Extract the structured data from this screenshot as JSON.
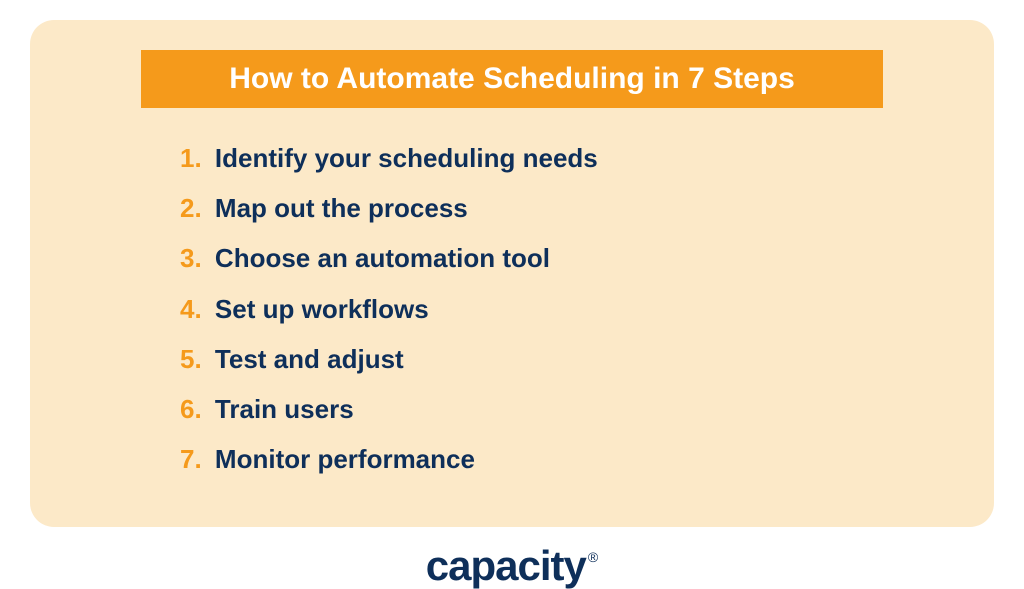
{
  "card": {
    "title": "How to Automate Scheduling in 7 Steps",
    "steps": [
      {
        "number": "1.",
        "text": "Identify your scheduling needs"
      },
      {
        "number": "2.",
        "text": "Map out the process"
      },
      {
        "number": "3.",
        "text": "Choose an automation tool"
      },
      {
        "number": "4.",
        "text": "Set up workflows"
      },
      {
        "number": "5.",
        "text": "Test and adjust"
      },
      {
        "number": "6.",
        "text": "Train users"
      },
      {
        "number": "7.",
        "text": " Monitor performance"
      }
    ]
  },
  "logo": {
    "text": "capacity",
    "registered": "®"
  },
  "colors": {
    "accent": "#f59a1b",
    "dark_blue": "#0e2f5a",
    "card_bg": "#fce9c8"
  }
}
